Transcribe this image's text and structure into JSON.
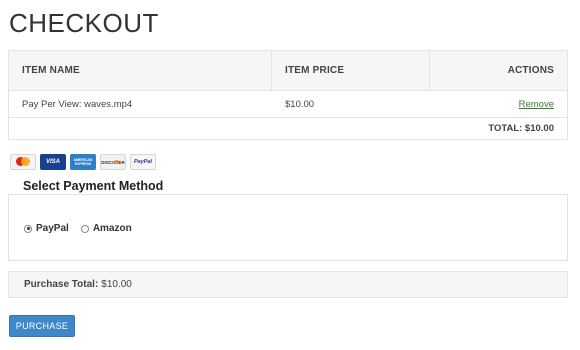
{
  "page": {
    "title": "CHECKOUT"
  },
  "cart": {
    "headers": {
      "item_name": "ITEM NAME",
      "item_price": "ITEM PRICE",
      "actions": "ACTIONS"
    },
    "rows": [
      {
        "name": "Pay Per View: waves.mp4",
        "price": "$10.00",
        "action": "Remove"
      }
    ],
    "total": "TOTAL: $10.00"
  },
  "payment_cards": {
    "mastercard": "MASTERCARD",
    "visa": "VISA",
    "amex": "AMERICAN EXPRESS",
    "discover": "DISCOVER",
    "paypal": "PayPal"
  },
  "payment": {
    "title": "Select Payment Method",
    "options": [
      {
        "label": "PayPal",
        "selected": true
      },
      {
        "label": "Amazon",
        "selected": false
      }
    ]
  },
  "summary": {
    "label": "Purchase Total:",
    "value": "$10.00"
  },
  "actions": {
    "purchase_label": "PURCHASE"
  },
  "colors": {
    "primary_button": "#3f87c8",
    "link": "#3c7d2b",
    "header_bg": "#f6f6f6"
  }
}
